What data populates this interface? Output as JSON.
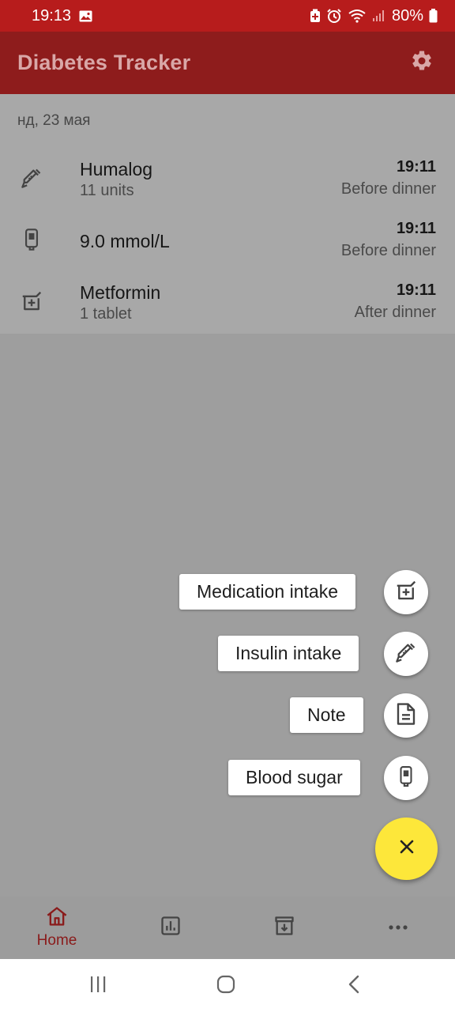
{
  "status_bar": {
    "time": "19:13",
    "battery": "80%",
    "icons": [
      "gallery-icon",
      "battery-saver-icon",
      "alarm-icon",
      "wifi-icon",
      "signal-icon",
      "battery-icon"
    ]
  },
  "app_bar": {
    "title": "Diabetes Tracker",
    "settings_icon": "gear-icon"
  },
  "colors": {
    "app_bar": "#8e1c1c",
    "status_bar": "#b71c1c",
    "fab": "#fde73a",
    "nav_active": "#8a1b1b"
  },
  "list": {
    "date": "нд, 23 мая",
    "entries": [
      {
        "icon": "syringe-icon",
        "title": "Humalog",
        "sub": "11 units",
        "time": "19:11",
        "meal": "Before dinner"
      },
      {
        "icon": "glucometer-icon",
        "title": "9.0 mmol/L",
        "sub": "",
        "time": "19:11",
        "meal": "Before dinner"
      },
      {
        "icon": "medication-icon",
        "title": "Metformin",
        "sub": "1 tablet",
        "time": "19:11",
        "meal": "After dinner"
      }
    ]
  },
  "speed_dial": {
    "medication": "Medication intake",
    "insulin": "Insulin intake",
    "note": "Note",
    "blood_sugar": "Blood sugar",
    "close_icon": "close-icon"
  },
  "bottom_nav": {
    "home_label": "Home",
    "items": [
      "home-icon",
      "chart-icon",
      "archive-icon",
      "more-icon"
    ]
  },
  "system_nav": [
    "recents-icon",
    "home-circle-icon",
    "back-icon"
  ]
}
